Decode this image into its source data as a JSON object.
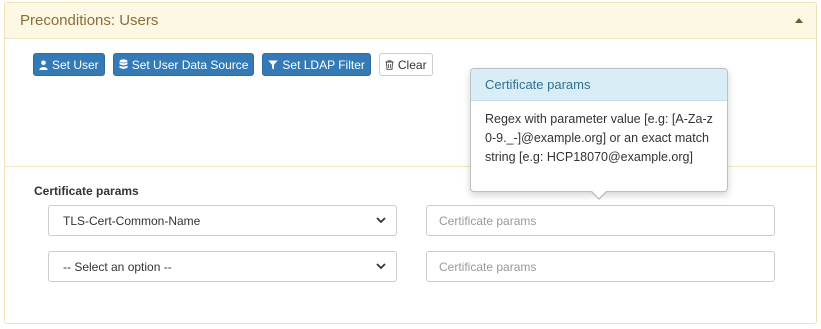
{
  "panel": {
    "title": "Preconditions: Users",
    "collapse_icon": "caret-up-icon",
    "header_bg": "#fcf8e3",
    "title_color": "#8a6d3b"
  },
  "toolbar": {
    "primary_color": "#337ab7",
    "buttons": [
      {
        "label": "Set User",
        "icon": "user-icon"
      },
      {
        "label": "Set User Data Source",
        "icon": "database-icon"
      },
      {
        "label": "Set LDAP Filter",
        "icon": "filter-icon"
      },
      {
        "label": "Clear",
        "icon": "trash-icon"
      }
    ]
  },
  "certificate_params": {
    "label": "Certificate params",
    "rows": [
      {
        "select_value": "TLS-Cert-Common-Name",
        "input_value": "",
        "input_placeholder": "Certificate params"
      },
      {
        "select_value": "-- Select an option --",
        "input_value": "",
        "input_placeholder": "Certificate params"
      }
    ]
  },
  "popover": {
    "title": "Certificate params",
    "content": "Regex with parameter value [e.g: [A-Za-z0-9._-]@example.org] or an exact match string [e.g: HCP18070@example.org]",
    "title_bg": "#d9edf7",
    "title_color": "#31708f"
  }
}
